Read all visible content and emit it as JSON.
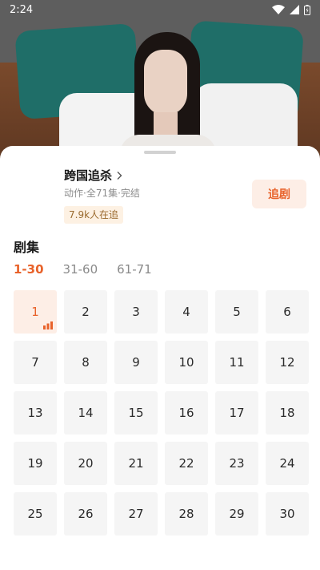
{
  "statusbar": {
    "time": "2:24"
  },
  "show": {
    "title": "跨国追杀",
    "meta": "动作·全71集·完结",
    "followers": "7.9k人在追",
    "follow_label": "追剧"
  },
  "episodes_section": {
    "title": "剧集",
    "ranges": [
      "1-30",
      "31-60",
      "61-71"
    ],
    "active_range": "1-30",
    "episodes": [
      "1",
      "2",
      "3",
      "4",
      "5",
      "6",
      "7",
      "8",
      "9",
      "10",
      "11",
      "12",
      "13",
      "14",
      "15",
      "16",
      "17",
      "18",
      "19",
      "20",
      "21",
      "22",
      "23",
      "24",
      "25",
      "26",
      "27",
      "28",
      "29",
      "30"
    ],
    "current_episode": "1"
  },
  "colors": {
    "accent": "#e8622a",
    "accent_bg": "#fdeee6",
    "badge_bg": "#fdf1e3",
    "badge_text": "#9a6a2e",
    "tile_bg": "#f5f5f5"
  },
  "icons": {
    "status": [
      "wifi-icon",
      "signal-icon",
      "battery-icon"
    ],
    "title_chevron": "chevron-right-icon",
    "now_playing": "playing-bars-icon"
  }
}
